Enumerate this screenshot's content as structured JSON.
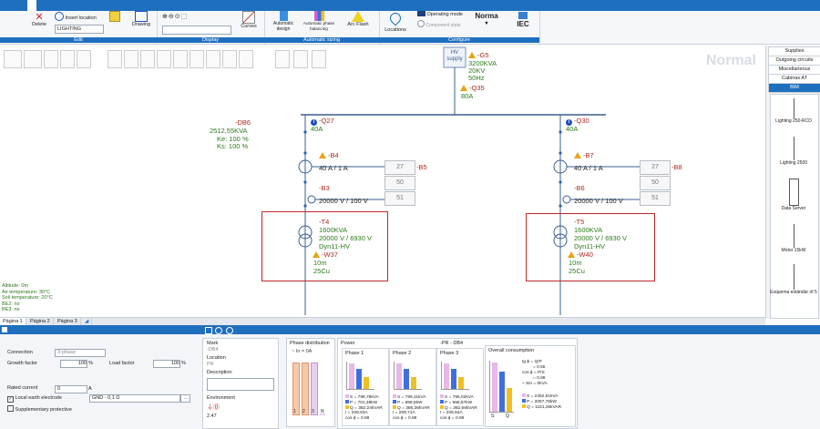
{
  "ribbon": {
    "tabs": [
      "",
      "",
      ""
    ],
    "groups": {
      "edit": {
        "label": "Edit",
        "delete": "Delete",
        "insert_location": "Insert location",
        "lighting": "LIGHTING",
        "drawing": "Drawing"
      },
      "display": {
        "label": "Display",
        "curves": "Curves"
      },
      "sizing": {
        "label": "Automatic sizing",
        "auto_design": "Automatic design",
        "auto_phase": "Automatic phase balancing",
        "arc_flash": "Arc Flash"
      },
      "configure": {
        "label": "Configure",
        "locations": "Locations",
        "operating_mode": "Operating mode",
        "component_state": "Component state",
        "norma": "Norma",
        "iec": "IEC"
      }
    }
  },
  "canvas": {
    "mode_watermark": "Normal",
    "hv_supply": "HV supply",
    "g5": {
      "id": "-G5",
      "power": "3200KVA",
      "voltage": "20KV",
      "freq": "50Hz"
    },
    "q35": {
      "id": "-Q35",
      "current": "80A"
    },
    "db6": {
      "id": "-DB6",
      "power": "2512,55KVA",
      "ke": "Ke: 100 %",
      "ks": "Ks: 100 %"
    },
    "left": {
      "q": {
        "id": "-Q27",
        "current": "40A"
      },
      "b": {
        "id": "-B4",
        "ratio": "40 A / 1 A"
      },
      "b3": {
        "id": "-B3",
        "ratio": "20000 V / 100 V"
      },
      "relay": {
        "id": "-B5",
        "codes": [
          "27",
          "50",
          "51"
        ]
      },
      "t": {
        "id": "-T4",
        "power": "1600KVA",
        "ratio": "20000 V / 6930 V",
        "group": "Dyn11-HV"
      },
      "w": {
        "id": "-W37",
        "length": "10m",
        "cable": "25Cu"
      }
    },
    "right": {
      "q": {
        "id": "-Q30",
        "current": "40A"
      },
      "b": {
        "id": "-B7",
        "ratio": "40 A / 1 A"
      },
      "b3": {
        "id": "-B6",
        "ratio": "20000 V / 100 V"
      },
      "relay": {
        "id": "-B8",
        "codes": [
          "27",
          "50",
          "51"
        ]
      },
      "t": {
        "id": "-T5",
        "power": "1600KVA",
        "ratio": "20000 V / 6930 V",
        "group": "Dyn11-HV"
      },
      "w": {
        "id": "-W40",
        "length": "10m",
        "cable": "25Cu"
      }
    },
    "conditions": [
      "Altitude: 0m",
      "Air temperature: 30°C",
      "Soil temperature: 20°C",
      "BE2: no",
      "BE3: no"
    ]
  },
  "right_panel": {
    "tabs": [
      "Supplies",
      "Outgoing circuits",
      "Miscellaneous",
      "Cabinas AT",
      "BIM"
    ],
    "items": [
      "Lighting 250-RCD",
      "Lighting 2500",
      "Data Server",
      "Motor 15kW",
      "Esquema estándar of 5"
    ]
  },
  "pages": [
    "Página 1",
    "Página 2",
    "Página 3"
  ],
  "bottom": {
    "connection_label": "Connection",
    "connection_value": "3-phase",
    "growth_label": "Growth factor",
    "growth_value": "100",
    "growth_unit": "%",
    "load_label": "Load factor",
    "load_value": "100",
    "load_unit": "%",
    "rated_label": "Rated current",
    "rated_value": "0",
    "rated_unit": "A",
    "local_earth": "Local earth electrode",
    "gnd_value": "GND - 0,1 Ω",
    "supp": "Supplementary protective",
    "mark_label": "Mark",
    "mark_value": "-DB4",
    "location_label": "Location",
    "location_value": "PR",
    "description_label": "Description",
    "environment_label": "Environment",
    "env_value": "2.47",
    "phase_dist_title": "Phase distribution",
    "in_label": "~ In = 0A",
    "phase_bars": [
      "1",
      "2",
      "3",
      "N"
    ],
    "power_title": "Power",
    "db_label": "-PR - DB4",
    "phases": [
      {
        "title": "Phase 1",
        "S": "S = 798,78kVA",
        "P": "P = 701,39kW",
        "Q": "Q = 382,24kVAR",
        "I": "I = 209,63A",
        "cos": "cos ϕ = 0.88"
      },
      {
        "title": "Phase 2",
        "S": "S = 799,11kVA",
        "P": "P = 699,5kW",
        "Q": "Q = 386,36kVAR",
        "I": "I = 209,71A",
        "cos": "cos ϕ = 0.88"
      },
      {
        "title": "Phase 3",
        "S": "S = 795,02kVA",
        "P": "P = 696,87kW",
        "Q": "Q = 382,66kVAR",
        "I": "I = 208,64A",
        "cos": "cos ϕ = 0.88"
      }
    ],
    "overall_title": "Overall consumption",
    "overall": {
      "tg": "tg ϕ = Q/P",
      "tgv": "= 0.55",
      "cos": "cos ϕ = P/S",
      "cosv": "= 0.88",
      "sin": "~ Sin = 0kVA",
      "S": "S = 2392,91kVA",
      "P": "P = 2097,76kW",
      "Q": "Q = 1151,26kVAR"
    },
    "overall_axis": [
      "S",
      "Q"
    ]
  },
  "colors": {
    "accent": "#1f6fbf",
    "green": "#2a7a1a",
    "red": "#b0281e",
    "s_bar": "#cc66cc",
    "p_bar": "#3f6fdf",
    "q_bar": "#f0c020"
  }
}
